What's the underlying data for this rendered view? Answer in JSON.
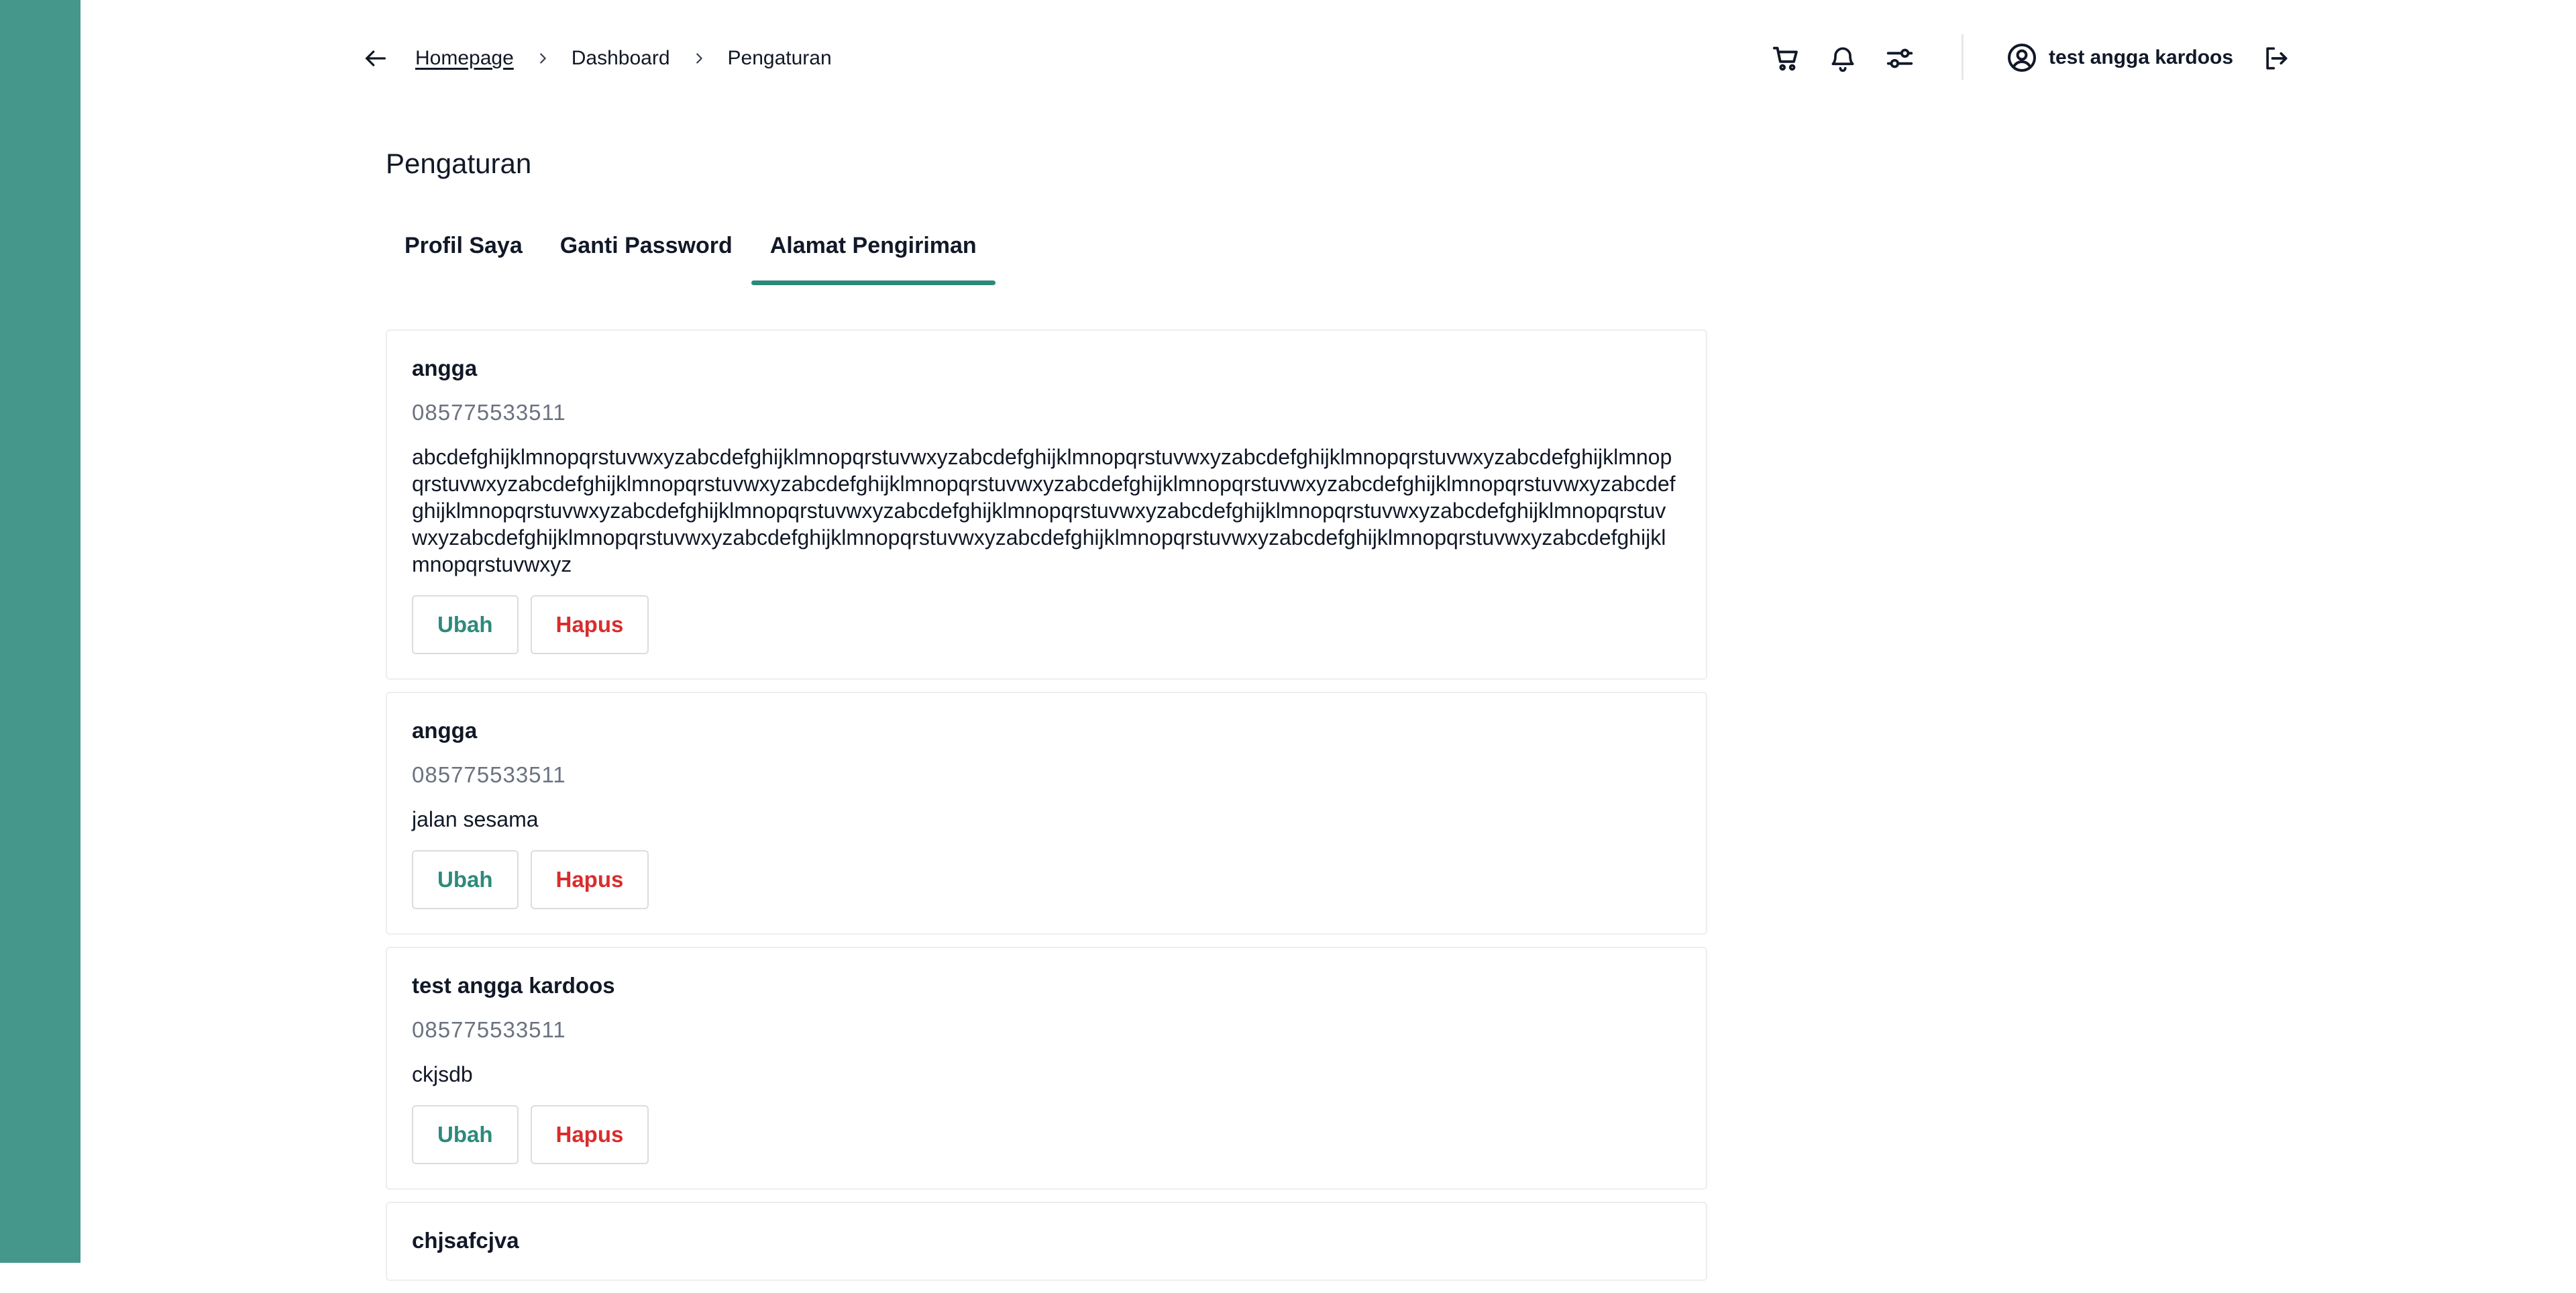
{
  "header": {
    "breadcrumb": [
      {
        "label": "Homepage"
      },
      {
        "label": "Dashboard"
      },
      {
        "label": "Pengaturan"
      }
    ],
    "user_name": "test angga kardoos",
    "icons": [
      "arrow-left-icon",
      "chevron-right-icon",
      "cart-icon",
      "bell-icon",
      "sliders-icon",
      "user-circle-icon",
      "logout-icon"
    ]
  },
  "page": {
    "title": "Pengaturan",
    "tabs": [
      {
        "label": "Profil Saya",
        "active": false
      },
      {
        "label": "Ganti Password",
        "active": false
      },
      {
        "label": "Alamat Pengiriman",
        "active": true
      }
    ]
  },
  "addresses": [
    {
      "name": "angga",
      "phone": "085775533511",
      "address": "abcdefghijklmnopqrstuvwxyzabcdefghijklmnopqrstuvwxyzabcdefghijklmnopqrstuvwxyzabcdefghijklmnopqrstuvwxyzabcdefghijklmnopqrstuvwxyzabcdefghijklmnopqrstuvwxyzabcdefghijklmnopqrstuvwxyzabcdefghijklmnopqrstuvwxyzabcdefghijklmnopqrstuvwxyzabcdefghijklmnopqrstuvwxyzabcdefghijklmnopqrstuvwxyzabcdefghijklmnopqrstuvwxyzabcdefghijklmnopqrstuvwxyzabcdefghijklmnopqrstuvwxyzabcdefghijklmnopqrstuvwxyzabcdefghijklmnopqrstuvwxyzabcdefghijklmnopqrstuvwxyzabcdefghijklmnopqrstuvwxyzabcdefghijklmnopqrstuvwxyz",
      "edit_label": "Ubah",
      "delete_label": "Hapus"
    },
    {
      "name": "angga",
      "phone": "085775533511",
      "address": "jalan sesama",
      "edit_label": "Ubah",
      "delete_label": "Hapus"
    },
    {
      "name": "test angga kardoos",
      "phone": "085775533511",
      "address": "ckjsdb",
      "edit_label": "Ubah",
      "delete_label": "Hapus"
    },
    {
      "name": "chjsafcjva",
      "phone": "",
      "address": "",
      "edit_label": "",
      "delete_label": ""
    }
  ],
  "colors": {
    "sidebar": "#44978a",
    "accent": "#2d8a7b",
    "danger": "#d92d2d"
  }
}
